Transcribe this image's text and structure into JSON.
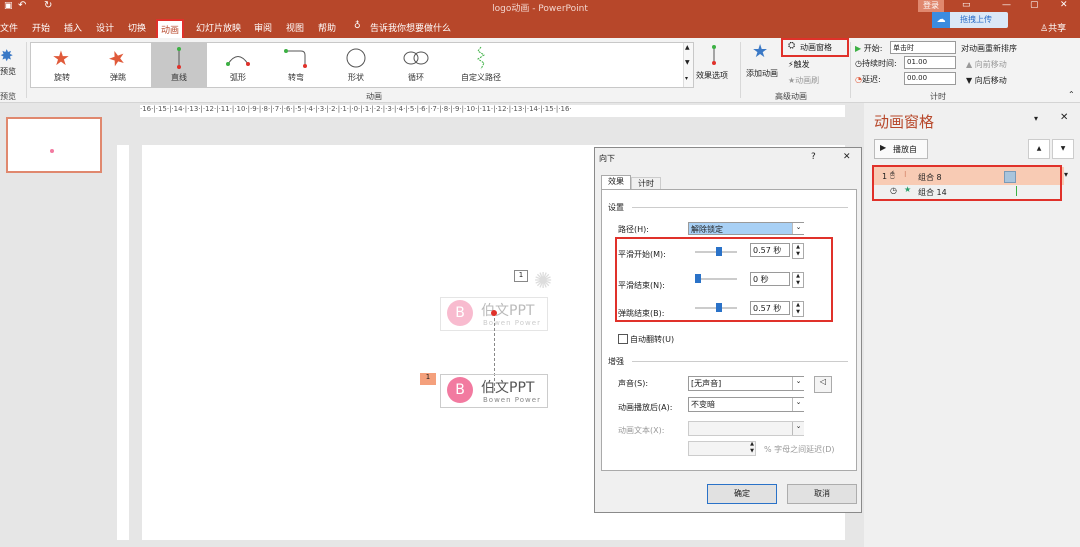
{
  "titlebar": {
    "title": "logo动画 - PowerPoint",
    "login": "登录"
  },
  "tabs": [
    {
      "label": "文件",
      "active": false
    },
    {
      "label": "开始",
      "active": false
    },
    {
      "label": "插入",
      "active": false
    },
    {
      "label": "设计",
      "active": false
    },
    {
      "label": "切换",
      "active": false
    },
    {
      "label": "动画",
      "active": true
    },
    {
      "label": "幻灯片放映",
      "active": false
    },
    {
      "label": "审阅",
      "active": false
    },
    {
      "label": "视图",
      "active": false
    },
    {
      "label": "帮助",
      "active": false
    }
  ],
  "tellme": "告诉我你想要做什么",
  "upload_label": "拖拽上传",
  "share_label": "共享",
  "ribbon": {
    "preview_label": "预览",
    "preview_group": "预览",
    "gallery": [
      {
        "label": "旋转",
        "icon": "spin-star-icon"
      },
      {
        "label": "弹跳",
        "icon": "bounce-star-icon"
      },
      {
        "label": "直线",
        "icon": "line-path-icon",
        "selected": true
      },
      {
        "label": "弧形",
        "icon": "arc-path-icon"
      },
      {
        "label": "转弯",
        "icon": "turn-path-icon"
      },
      {
        "label": "形状",
        "icon": "shape-path-icon"
      },
      {
        "label": "循环",
        "icon": "loop-path-icon"
      },
      {
        "label": "自定义路径",
        "icon": "custom-path-icon"
      }
    ],
    "animation_group": "动画",
    "effect_options": "效果选项",
    "add_animation": "添加动画",
    "anim_pane_btn": "动画窗格",
    "trigger": "触发",
    "anim_painter": "动画刷",
    "advanced_group": "高级动画",
    "start_label": "开始:",
    "start_value": "单击时",
    "duration_label": "持续时间:",
    "duration_value": "01.00",
    "delay_label": "延迟:",
    "delay_value": "00.00",
    "reorder_title": "对动画重新排序",
    "move_earlier": "向前移动",
    "move_later": "向后移动",
    "timing_group": "计时"
  },
  "ruler_text": "·16·|·15·|·14·|·13·|·12·|·11·|·10·|·9·|·8·|·7·|·6·|·5·|·4·|·3·|·2·|·1·|·0·|·1·|·2·|·3·|·4·|·5·|·6·|·7·|·8·|·9·|·10·|·11·|·12·|·13·|·14·|·15·|·16·",
  "slide": {
    "badge_top": "1",
    "badge_bottom": "1",
    "logo_letter": "B",
    "logo_text": "伯文PPT",
    "logo_sub": "Bowen Power"
  },
  "dialog": {
    "title": "向下",
    "help": "?",
    "close": "✕",
    "tabs": [
      "效果",
      "计时"
    ],
    "settings": "设置",
    "path_label": "路径(H):",
    "path_value": "解除锁定",
    "smooth_start_label": "平滑开始(M):",
    "smooth_start_value": "0.57 秒",
    "smooth_start_pct": 0.57,
    "smooth_end_label": "平滑结束(N):",
    "smooth_end_value": "0 秒",
    "smooth_end_pct": 0.0,
    "bounce_end_label": "弹跳结束(B):",
    "bounce_end_value": "0.57 秒",
    "bounce_end_pct": 0.57,
    "auto_reverse": "自动翻转(U)",
    "enhance": "增强",
    "sound_label": "声音(S):",
    "sound_value": "[无声音]",
    "after_label": "动画播放后(A):",
    "after_value": "不变暗",
    "text_label": "动画文本(X):",
    "delay_suffix": "% 字母之间延迟(D)",
    "ok": "确定",
    "cancel": "取消"
  },
  "animpane": {
    "title": "动画窗格",
    "play_from": "播放自",
    "items": [
      {
        "num": "1",
        "name": "组合 8",
        "selected": true
      },
      {
        "num": "",
        "name": "组合 14",
        "selected": false
      }
    ]
  },
  "colors": {
    "accent": "#b7472a",
    "highlight": "#e0312a",
    "logo": "#f27aa0"
  }
}
